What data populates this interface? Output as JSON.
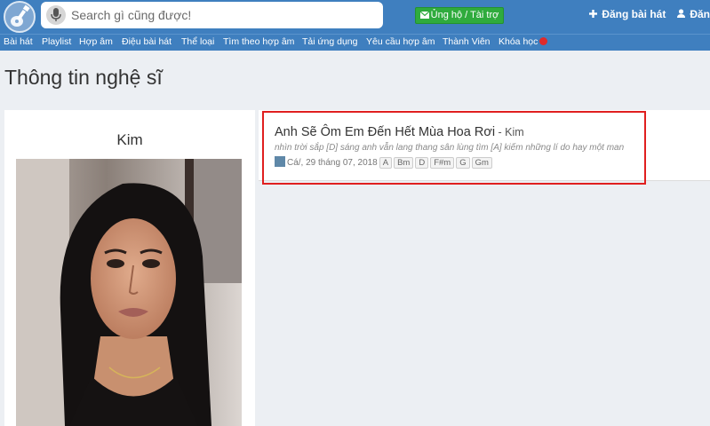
{
  "header": {
    "logo_icon": "guitar-logo-icon",
    "search": {
      "placeholder": "Search gì cũng được!",
      "value": ""
    },
    "donate_label": "Ủng hộ / Tài trợ",
    "post_song_label": "Đăng bài hát",
    "login_label": "Đăng"
  },
  "nav": {
    "items": [
      {
        "label": "Bài hát"
      },
      {
        "label": "Playlist"
      },
      {
        "label": "Hợp âm"
      },
      {
        "label": "Điệu bài hát"
      },
      {
        "label": "Thể loại"
      },
      {
        "label": "Tìm theo hợp âm"
      },
      {
        "label": "Tải ứng dụng"
      },
      {
        "label": "Yêu cầu hợp âm"
      },
      {
        "label": "Thành Viên"
      },
      {
        "label": "Khóa học"
      }
    ]
  },
  "page": {
    "title": "Thông tin nghệ sĩ"
  },
  "artist": {
    "name": "Kim"
  },
  "song": {
    "title": "Anh Sẽ Ôm Em Đến Hết Mùa Hoa Rơi",
    "separator": " - ",
    "artist": "Kim",
    "lyric_snippet": "nhìn trời sắp [D] sáng anh vẫn lang thang sân lùng tìm [A] kiếm những lí do hay một man",
    "meta": "Cá/, 29 tháng 07, 2018",
    "chords": [
      "A",
      "Bm",
      "D",
      "F#m",
      "G",
      "Gm"
    ]
  },
  "colors": {
    "header_bg": "#3f7fbf",
    "donate_bg": "#2fab3d",
    "highlight": "#e01f1f",
    "page_bg": "#eceff3"
  }
}
